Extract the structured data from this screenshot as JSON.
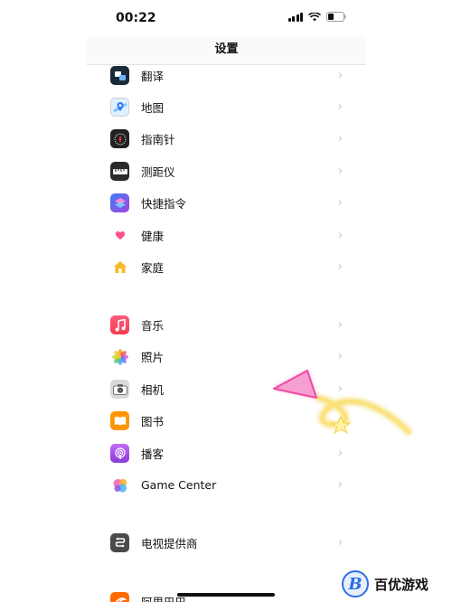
{
  "status_bar": {
    "time": "00:22"
  },
  "nav": {
    "title": "设置"
  },
  "items": [
    {
      "key": "translate",
      "label": "翻译",
      "icon": "translate-icon",
      "color": "#1b2a3a"
    },
    {
      "key": "maps",
      "label": "地图",
      "icon": "maps-icon",
      "color": "#6fc3ff"
    },
    {
      "key": "compass",
      "label": "指南针",
      "icon": "compass-icon",
      "color": "#222222"
    },
    {
      "key": "measure",
      "label": "测距仪",
      "icon": "measure-icon",
      "color": "#2b2b2b"
    },
    {
      "key": "shortcuts",
      "label": "快捷指令",
      "icon": "shortcuts-icon",
      "color": "#5a4de0"
    },
    {
      "key": "health",
      "label": "健康",
      "icon": "health-heart-icon",
      "color": "#ff4f8b"
    },
    {
      "key": "home",
      "label": "家庭",
      "icon": "home-icon",
      "color": "#f7b928"
    },
    {
      "key": "music",
      "label": "音乐",
      "icon": "music-icon",
      "color": "#fa3c5a"
    },
    {
      "key": "photos",
      "label": "照片",
      "icon": "photos-icon",
      "color": "#f5a623"
    },
    {
      "key": "camera",
      "label": "相机",
      "icon": "camera-icon",
      "color": "#8e8e93"
    },
    {
      "key": "books",
      "label": "图书",
      "icon": "books-icon",
      "color": "#ff9500"
    },
    {
      "key": "podcasts",
      "label": "播客",
      "icon": "podcasts-icon",
      "color": "#a35bf0"
    },
    {
      "key": "game-center",
      "label": "Game Center",
      "icon": "game-center-icon",
      "color": "#e85cb5"
    },
    {
      "key": "tv-provider",
      "label": "电视提供商",
      "icon": "tv-provider-icon",
      "color": "#4a4a4a"
    },
    {
      "key": "alibaba",
      "label": "阿里巴巴",
      "icon": "alibaba-icon",
      "color": "#ff6a00"
    }
  ],
  "chevron": "›",
  "watermark": {
    "logo_letter": "B",
    "text": "百优游戏"
  },
  "colors": {
    "annotation_pink": "#f04aa5",
    "annotation_yellow": "#f5d34a"
  }
}
